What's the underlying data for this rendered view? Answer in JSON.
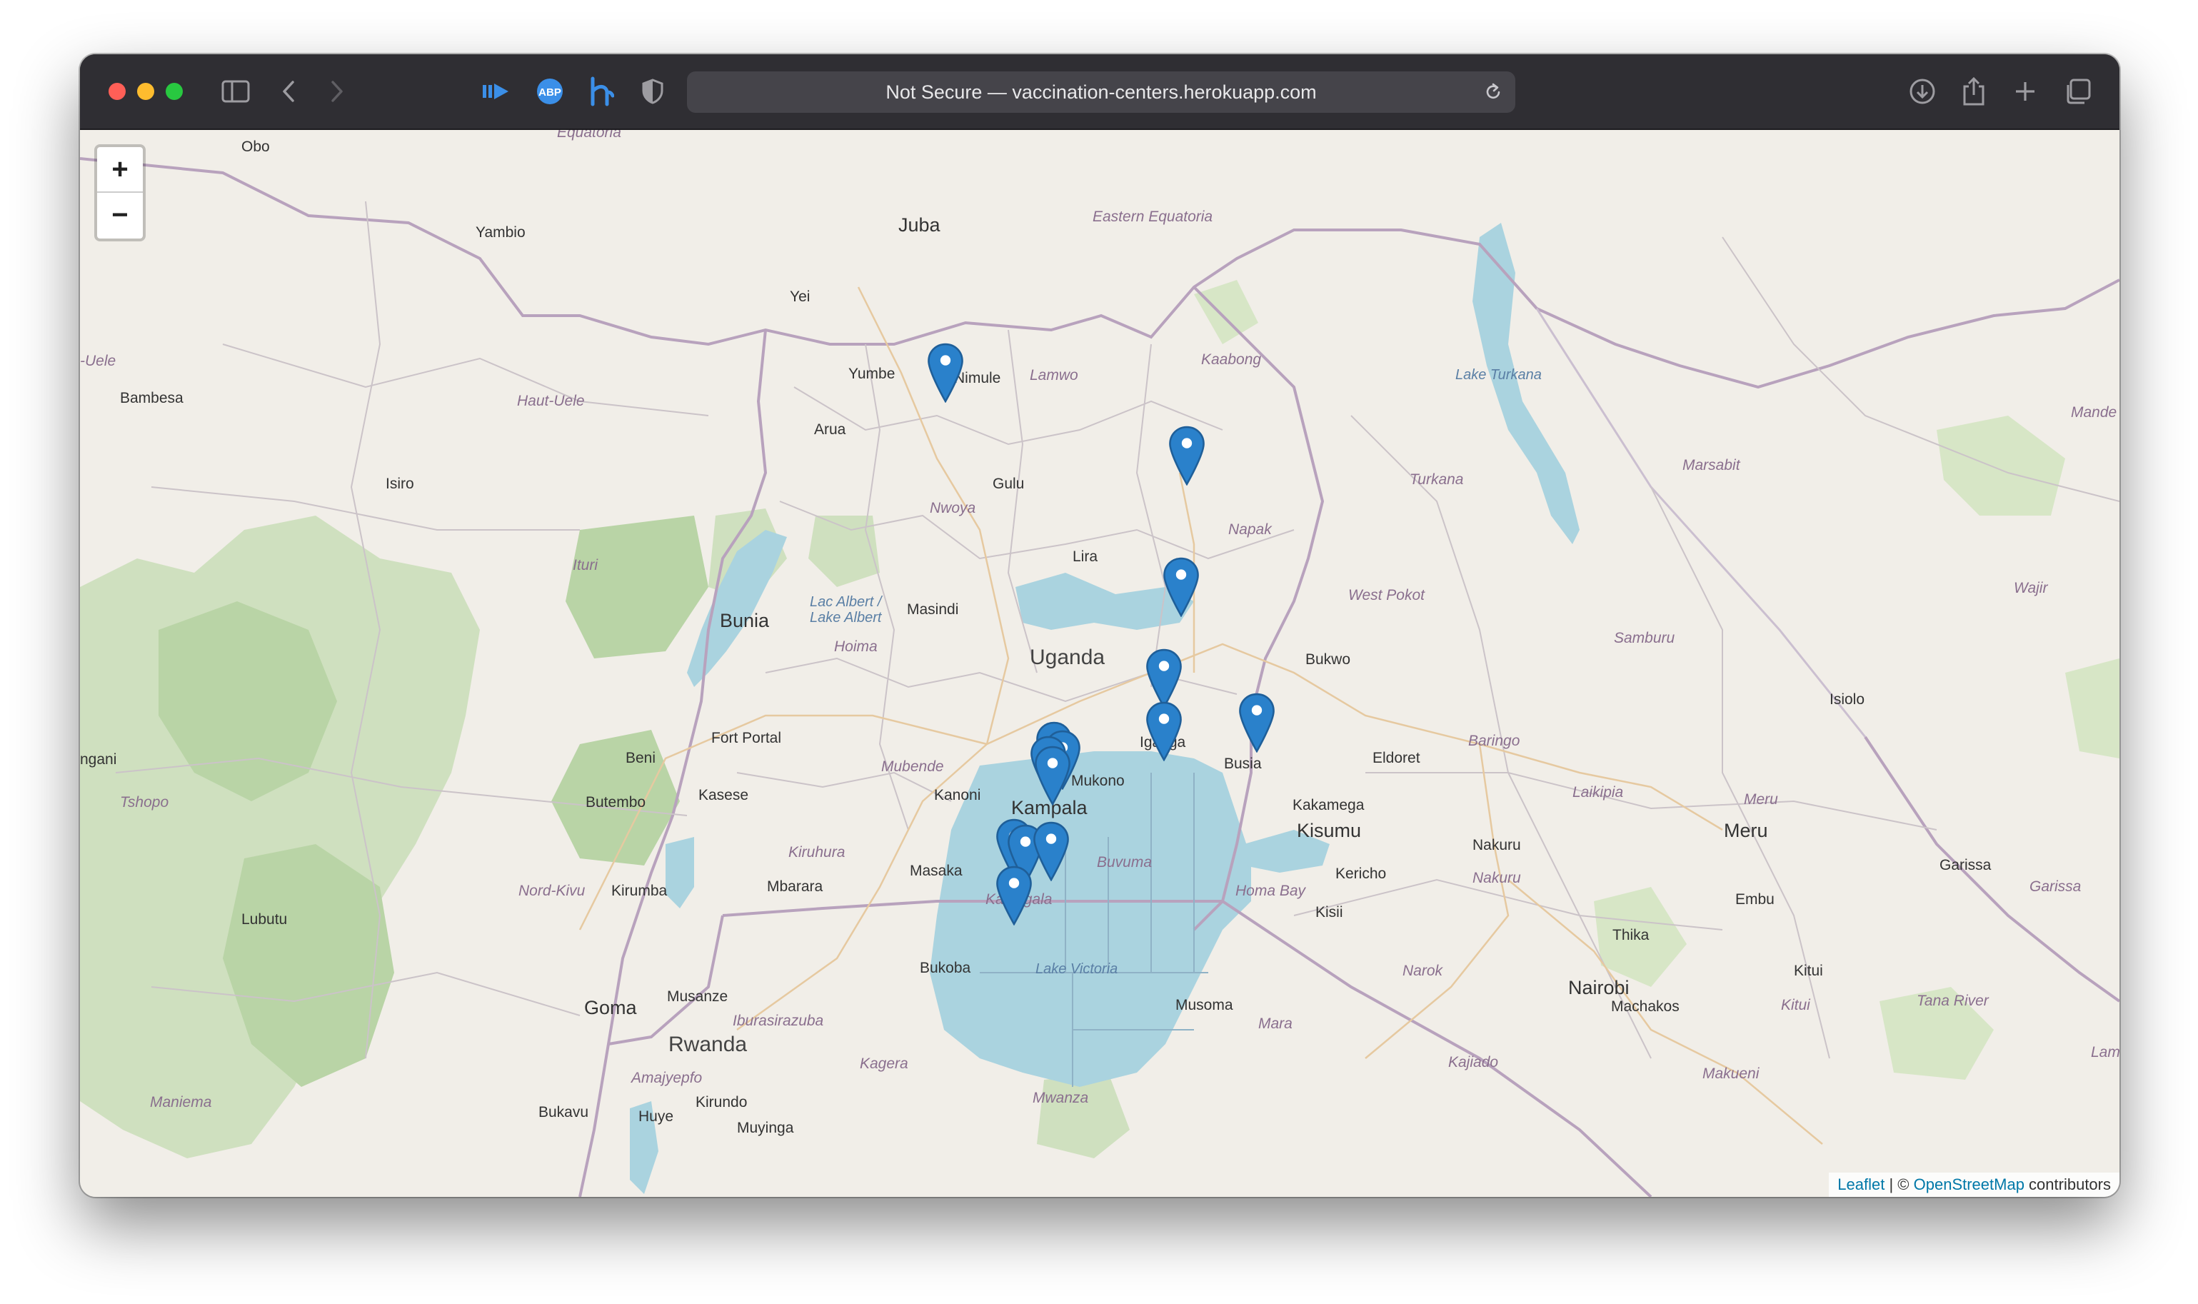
{
  "browser": {
    "address_text": "Not Secure — vaccination-centers.herokuapp.com"
  },
  "map": {
    "zoom_in_label": "+",
    "zoom_out_label": "−",
    "attribution": {
      "leaflet": "Leaflet",
      "separator": " | © ",
      "osm": "OpenStreetMap",
      "suffix": " contributors"
    },
    "labels": {
      "obo": "Obo",
      "equatoria": "Equatoria",
      "juba": "Juba",
      "eastern_equatoria": "Eastern Equatoria",
      "yambio": "Yambio",
      "yei": "Yei",
      "uele": "-Uele",
      "bambesa": "Bambesa",
      "haut_uele": "Haut-Uele",
      "yumbe": "Yumbe",
      "nimule": "Nimule",
      "lamwo": "Lamwo",
      "kaabong": "Kaabong",
      "lake_turkana": "Lake Turkana",
      "mande": "Mande",
      "arua": "Arua",
      "isiro": "Isiro",
      "gulu": "Gulu",
      "nwoya": "Nwoya",
      "napak": "Napak",
      "turkana": "Turkana",
      "marsabit": "Marsabit",
      "ituri": "Ituri",
      "lira": "Lira",
      "lake_albert_1": "Lac Albert /",
      "lake_albert_2": "Lake Albert",
      "masindi": "Masindi",
      "bunia": "Bunia",
      "hoima": "Hoima",
      "uganda": "Uganda",
      "west_pokot": "West Pokot",
      "wajir": "Wajir",
      "bukwo": "Bukwo",
      "samburu": "Samburu",
      "isiolo": "Isiolo",
      "fort_portal": "Fort Portal",
      "baringo": "Baringo",
      "beni": "Beni",
      "mubende": "Mubende",
      "iganga": "Iganga",
      "busia": "Busia",
      "eldoret": "Eldoret",
      "ngani": "ngani",
      "mukono": "Mukono",
      "laikipia": "Laikipia",
      "kasese": "Kasese",
      "kanoni": "Kanoni",
      "kampala": "Kampala",
      "kakamega": "Kakamega",
      "meru_region": "Meru",
      "tshopo": "Tshopo",
      "butembo": "Butembo",
      "kisumu": "Kisumu",
      "meru": "Meru",
      "kiruhura": "Kiruhura",
      "buvuma": "Buvuma",
      "nakuru": "Nakuru",
      "nakuru_region": "Nakuru",
      "garissa": "Garissa",
      "masaka": "Masaka",
      "kericho": "Kericho",
      "garissa_region": "Garissa",
      "nord_kivu": "Nord-Kivu",
      "kirumba": "Kirumba",
      "mbarara": "Mbarara",
      "homa_bay": "Homa Bay",
      "embu": "Embu",
      "kalangala": "Kalangala",
      "kisii": "Kisii",
      "lubutu": "Lubutu",
      "thika": "Thika",
      "bukoba": "Bukoba",
      "lake_victoria": "Lake Victoria",
      "narok": "Narok",
      "kitui": "Kitui",
      "nairobi": "Nairobi",
      "musanze": "Musanze",
      "goma": "Goma",
      "musoma": "Musoma",
      "machakos": "Machakos",
      "kitui_region": "Kitui",
      "tana_river": "Tana River",
      "rwanda": "Rwanda",
      "iburasirazuba": "Iburasirazuba",
      "mara": "Mara",
      "amajyepfo": "Amajyepfo",
      "kagera": "Kagera",
      "kajiado": "Kajiado",
      "makueni": "Makueni",
      "lamu": "Lam",
      "maniema": "Maniema",
      "kirundo": "Kirundo",
      "mwanza": "Mwanza",
      "bukavu": "Bukavu",
      "huye": "Huye",
      "muyinga": "Muyinga"
    }
  },
  "colors": {
    "marker": "#2a81cb",
    "water": "#aad3df",
    "forest": "#add19e",
    "land": "#f1eee8",
    "border": "#b8a2bd"
  }
}
